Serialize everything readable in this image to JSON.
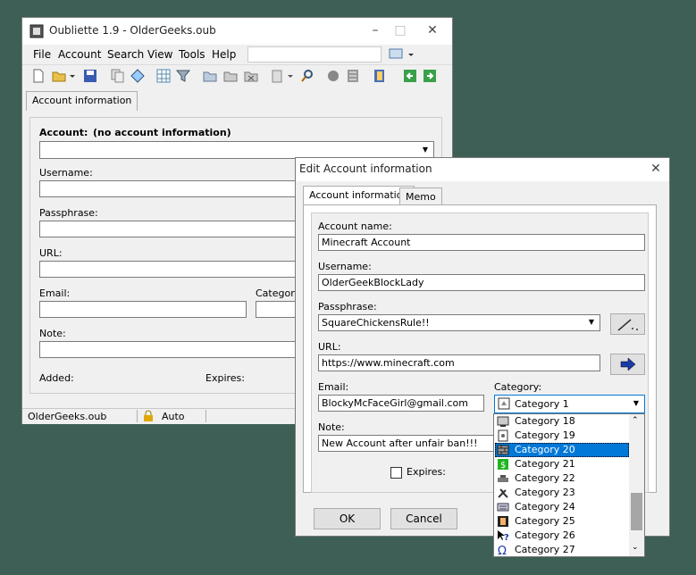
{
  "main_window": {
    "title": "Oubliette 1.9 - OlderGeeks.oub",
    "menu": [
      "File",
      "Account",
      "Search",
      "View",
      "Tools",
      "Help"
    ],
    "tab": "Account information",
    "account_label": "Account:",
    "account_value": "(no account information)",
    "username_label": "Username:",
    "passphrase_label": "Passphrase:",
    "url_label": "URL:",
    "email_label": "Email:",
    "category_label": "Category:",
    "note_label": "Note:",
    "added_label": "Added:",
    "expires_label": "Expires:",
    "status_file": "OlderGeeks.oub",
    "status_lock": "Auto"
  },
  "dialog": {
    "title": "Edit Account information",
    "tabs": [
      "Account information",
      "Memo"
    ],
    "account_name_label": "Account name:",
    "account_name_value": "Minecraft Account",
    "username_label": "Username:",
    "username_value": "OlderGeekBlockLady",
    "passphrase_label": "Passphrase:",
    "passphrase_value": "SquareChickensRule!!",
    "url_label": "URL:",
    "url_value": "https://www.minecraft.com",
    "email_label": "Email:",
    "email_value": "BlockyMcFaceGirl@gmail.com",
    "category_label": "Category:",
    "category_value": "Category 1",
    "note_label": "Note:",
    "note_value": "New Account after unfair ban!!!",
    "expires_label": "Expires:",
    "ok_label": "OK",
    "cancel_label": "Cancel"
  },
  "category_list": {
    "items": [
      "Category 18",
      "Category 19",
      "Category 20",
      "Category 21",
      "Category 22",
      "Category 23",
      "Category 24",
      "Category 25",
      "Category 26",
      "Category 27"
    ],
    "selected": "Category 20"
  },
  "colors": {
    "selection": "#0078d7",
    "background": "#3d5f56"
  }
}
